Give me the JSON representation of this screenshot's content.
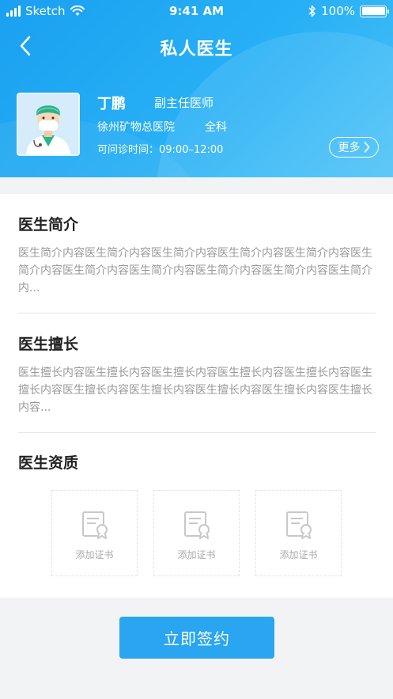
{
  "status_bar": {
    "carrier": "Sketch",
    "time": "9:41 AM",
    "battery": "100%"
  },
  "nav": {
    "title": "私人医生"
  },
  "doctor": {
    "name": "丁鹏",
    "title": "副主任医师",
    "hospital": "徐州矿物总医院",
    "department": "全科",
    "hours": "可问诊时间：09:00–12:00",
    "more_label": "更多"
  },
  "sections": {
    "intro": {
      "heading": "医生简介",
      "text": "医生简介内容医生简介内容医生简介内容医生简介内容医生简介内容医生简介内容医生简介内容医生简介内容医生简介内容医生简介内容医生简介内..."
    },
    "expertise": {
      "heading": "医生擅长",
      "text": "医生擅长内容医生擅长内容医生擅长内容医生擅长内容医生擅长内容医生擅长内容医生擅长内容医生擅长内容医生擅长内容医生擅长内容医生擅长内容..."
    },
    "qualification": {
      "heading": "医生资质",
      "certificates": [
        "添加证书",
        "添加证书",
        "添加证书"
      ]
    }
  },
  "actions": {
    "sign_label": "立即签约"
  },
  "colors": {
    "primary": "#29a6ef",
    "header_gradient_start": "#1aa0f0",
    "header_gradient_end": "#4cc3f7",
    "muted_text": "#999999",
    "page_background": "#f2f3f5"
  }
}
